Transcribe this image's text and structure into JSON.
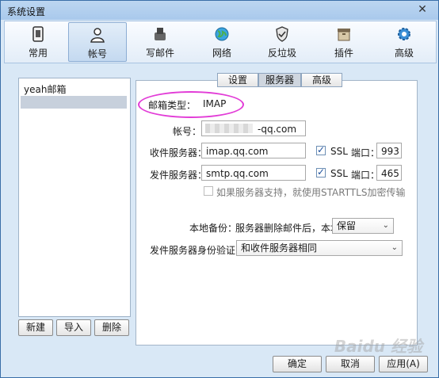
{
  "window": {
    "title": "系统设置"
  },
  "toolbar": {
    "items": [
      {
        "label": "常用",
        "icon": "general-icon"
      },
      {
        "label": "帐号",
        "icon": "account-icon"
      },
      {
        "label": "写邮件",
        "icon": "compose-icon"
      },
      {
        "label": "网络",
        "icon": "network-icon"
      },
      {
        "label": "反垃圾",
        "icon": "antispam-icon"
      },
      {
        "label": "插件",
        "icon": "plugin-icon"
      },
      {
        "label": "高级",
        "icon": "advanced-icon"
      }
    ],
    "active": "帐号"
  },
  "accounts": {
    "items": [
      "yeah邮箱"
    ],
    "buttons": {
      "new": "新建",
      "import": "导入",
      "delete": "删除"
    }
  },
  "tabs": {
    "settings": "设置",
    "server": "服务器",
    "advanced": "高级",
    "selected": "服务器"
  },
  "server": {
    "mailbox_type_label": "邮箱类型：",
    "mailbox_type_value": "IMAP",
    "account_label": "帐号：",
    "account_value": "-qq.com",
    "incoming_label": "收件服务器：",
    "incoming_value": "imap.qq.com",
    "incoming_ssl": "SSL",
    "incoming_port_label": "端口：",
    "incoming_port": "993",
    "outgoing_label": "发件服务器：",
    "outgoing_value": "smtp.qq.com",
    "outgoing_ssl": "SSL",
    "outgoing_port_label": "端口：",
    "outgoing_port": "465",
    "starttls_text": "如果服务器支持，就使用STARTTLS加密传输",
    "backup_label": "本地备份：",
    "backup_desc": "服务器删除邮件后，本地",
    "backup_value": "保留",
    "auth_label": "发件服务器身份验证：",
    "auth_value": "和收件服务器相同"
  },
  "footer": {
    "ok": "确定",
    "cancel": "取消",
    "apply": "应用(A)"
  },
  "watermark": "Baidu 经验"
}
